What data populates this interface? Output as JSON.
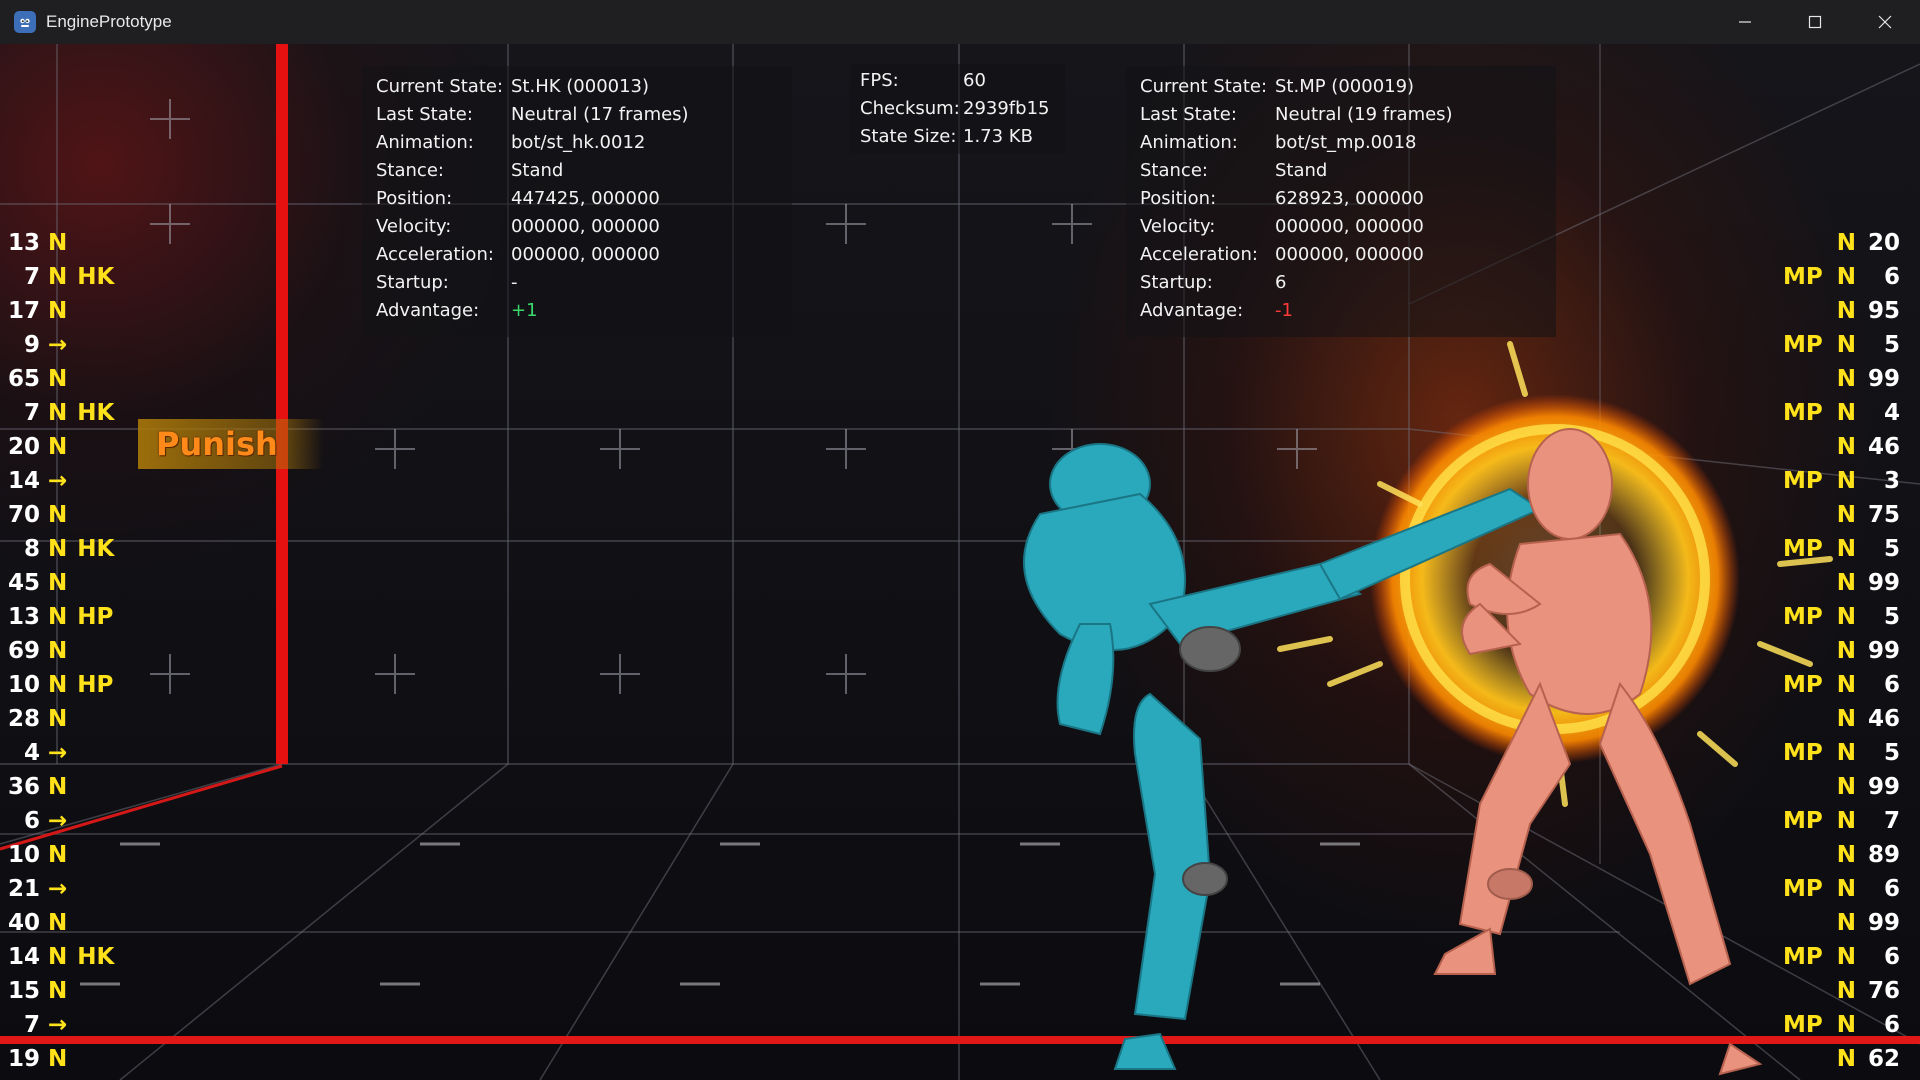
{
  "window": {
    "title": "EnginePrototype"
  },
  "colors": {
    "accent_input": "#ffe21a",
    "advantage_plus": "#38d86a",
    "advantage_minus": "#ff3a3a",
    "player1": "#2aa9bd",
    "player2": "#e9927e"
  },
  "player1": {
    "rows": [
      {
        "label": "Current State:",
        "value": "St.HK (000013)"
      },
      {
        "label": "Last State:",
        "value": "Neutral (17 frames)"
      },
      {
        "label": "Animation:",
        "value": "bot/st_hk.0012"
      },
      {
        "label": "Stance:",
        "value": "Stand"
      },
      {
        "label": "Position:",
        "value": "447425, 000000"
      },
      {
        "label": "Velocity:",
        "value": "000000, 000000"
      },
      {
        "label": "Acceleration:",
        "value": "000000, 000000"
      },
      {
        "label": "Startup:",
        "value": "-"
      },
      {
        "label": "Advantage:",
        "value": "+1"
      }
    ]
  },
  "player2": {
    "rows": [
      {
        "label": "Current State:",
        "value": "St.MP (000019)"
      },
      {
        "label": "Last State:",
        "value": "Neutral (19 frames)"
      },
      {
        "label": "Animation:",
        "value": "bot/st_mp.0018"
      },
      {
        "label": "Stance:",
        "value": "Stand"
      },
      {
        "label": "Position:",
        "value": "628923, 000000"
      },
      {
        "label": "Velocity:",
        "value": "000000, 000000"
      },
      {
        "label": "Acceleration:",
        "value": "000000, 000000"
      },
      {
        "label": "Startup:",
        "value": "6"
      },
      {
        "label": "Advantage:",
        "value": "-1"
      }
    ]
  },
  "stats": {
    "rows": [
      {
        "label": "FPS:",
        "value": "60"
      },
      {
        "label": "Checksum:",
        "value": "2939fb15"
      },
      {
        "label": "State Size:",
        "value": "1.73 KB"
      }
    ]
  },
  "punish_label": "Punish",
  "left_inputs": [
    {
      "frames": "13",
      "dir": "N",
      "btn": ""
    },
    {
      "frames": "7",
      "dir": "N",
      "btn": "HK"
    },
    {
      "frames": "17",
      "dir": "N",
      "btn": ""
    },
    {
      "frames": "9",
      "dir": "→",
      "btn": ""
    },
    {
      "frames": "65",
      "dir": "N",
      "btn": ""
    },
    {
      "frames": "7",
      "dir": "N",
      "btn": "HK"
    },
    {
      "frames": "20",
      "dir": "N",
      "btn": ""
    },
    {
      "frames": "14",
      "dir": "→",
      "btn": ""
    },
    {
      "frames": "70",
      "dir": "N",
      "btn": ""
    },
    {
      "frames": "8",
      "dir": "N",
      "btn": "HK"
    },
    {
      "frames": "45",
      "dir": "N",
      "btn": ""
    },
    {
      "frames": "13",
      "dir": "N",
      "btn": "HP"
    },
    {
      "frames": "69",
      "dir": "N",
      "btn": ""
    },
    {
      "frames": "10",
      "dir": "N",
      "btn": "HP"
    },
    {
      "frames": "28",
      "dir": "N",
      "btn": ""
    },
    {
      "frames": "4",
      "dir": "→",
      "btn": ""
    },
    {
      "frames": "36",
      "dir": "N",
      "btn": ""
    },
    {
      "frames": "6",
      "dir": "→",
      "btn": ""
    },
    {
      "frames": "10",
      "dir": "N",
      "btn": ""
    },
    {
      "frames": "21",
      "dir": "→",
      "btn": ""
    },
    {
      "frames": "40",
      "dir": "N",
      "btn": ""
    },
    {
      "frames": "14",
      "dir": "N",
      "btn": "HK"
    },
    {
      "frames": "15",
      "dir": "N",
      "btn": ""
    },
    {
      "frames": "7",
      "dir": "→",
      "btn": ""
    },
    {
      "frames": "19",
      "dir": "N",
      "btn": ""
    }
  ],
  "right_inputs": [
    {
      "btn": "",
      "dir": "N",
      "frames": "20"
    },
    {
      "btn": "MP",
      "dir": "N",
      "frames": "6"
    },
    {
      "btn": "",
      "dir": "N",
      "frames": "95"
    },
    {
      "btn": "MP",
      "dir": "N",
      "frames": "5"
    },
    {
      "btn": "",
      "dir": "N",
      "frames": "99"
    },
    {
      "btn": "MP",
      "dir": "N",
      "frames": "4"
    },
    {
      "btn": "",
      "dir": "N",
      "frames": "46"
    },
    {
      "btn": "MP",
      "dir": "N",
      "frames": "3"
    },
    {
      "btn": "",
      "dir": "N",
      "frames": "75"
    },
    {
      "btn": "MP",
      "dir": "N",
      "frames": "5"
    },
    {
      "btn": "",
      "dir": "N",
      "frames": "99"
    },
    {
      "btn": "MP",
      "dir": "N",
      "frames": "5"
    },
    {
      "btn": "",
      "dir": "N",
      "frames": "99"
    },
    {
      "btn": "MP",
      "dir": "N",
      "frames": "6"
    },
    {
      "btn": "",
      "dir": "N",
      "frames": "46"
    },
    {
      "btn": "MP",
      "dir": "N",
      "frames": "5"
    },
    {
      "btn": "",
      "dir": "N",
      "frames": "99"
    },
    {
      "btn": "MP",
      "dir": "N",
      "frames": "7"
    },
    {
      "btn": "",
      "dir": "N",
      "frames": "89"
    },
    {
      "btn": "MP",
      "dir": "N",
      "frames": "6"
    },
    {
      "btn": "",
      "dir": "N",
      "frames": "99"
    },
    {
      "btn": "MP",
      "dir": "N",
      "frames": "6"
    },
    {
      "btn": "",
      "dir": "N",
      "frames": "76"
    },
    {
      "btn": "MP",
      "dir": "N",
      "frames": "6"
    },
    {
      "btn": "",
      "dir": "N",
      "frames": "62"
    }
  ]
}
